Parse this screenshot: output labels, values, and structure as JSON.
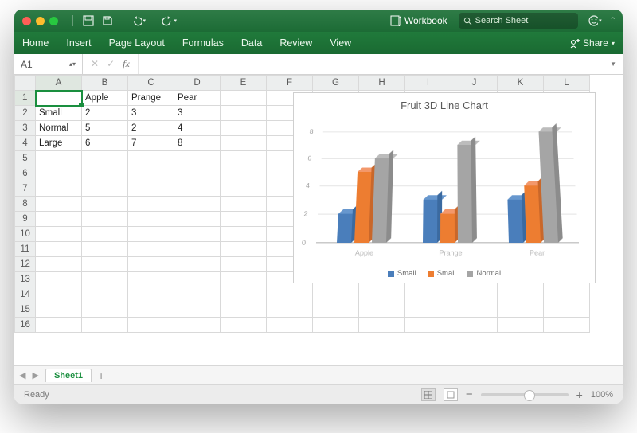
{
  "titlebar": {
    "workbook": "Workbook",
    "search_placeholder": "Search Sheet"
  },
  "ribbon": {
    "tabs": [
      "Home",
      "Insert",
      "Page Layout",
      "Formulas",
      "Data",
      "Review",
      "View"
    ],
    "share": "Share"
  },
  "fx": {
    "cell_ref": "A1"
  },
  "columns": [
    "A",
    "B",
    "C",
    "D",
    "E",
    "F",
    "G",
    "H",
    "I",
    "J",
    "K",
    "L"
  ],
  "rows": [
    "1",
    "2",
    "3",
    "4",
    "5",
    "6",
    "7",
    "8",
    "9",
    "10",
    "11",
    "12",
    "13",
    "14",
    "15",
    "16"
  ],
  "cells": {
    "B1": "Apple",
    "C1": "Prange",
    "D1": "Pear",
    "A2": "Small",
    "B2": "2",
    "C2": "3",
    "D2": "3",
    "A3": "Normal",
    "B3": "5",
    "C3": "2",
    "D3": "4",
    "A4": "Large",
    "B4": "6",
    "C4": "7",
    "D4": "8"
  },
  "chart_data": {
    "type": "bar",
    "title": "Fruit 3D Line Chart",
    "categories": [
      "Apple",
      "Prange",
      "Pear"
    ],
    "series": [
      {
        "name": "Small",
        "color": "#4a7ebb",
        "values": [
          2,
          3,
          3
        ]
      },
      {
        "name": "Small",
        "color": "#ed7d31",
        "values": [
          5,
          2,
          4
        ]
      },
      {
        "name": "Normal",
        "color": "#a5a5a5",
        "values": [
          6,
          7,
          8
        ]
      }
    ],
    "ylim": [
      0,
      8
    ],
    "yticks": [
      0,
      2,
      4,
      6,
      8
    ]
  },
  "tabs": {
    "sheet": "Sheet1"
  },
  "status": {
    "ready": "Ready",
    "zoom": "100%"
  }
}
